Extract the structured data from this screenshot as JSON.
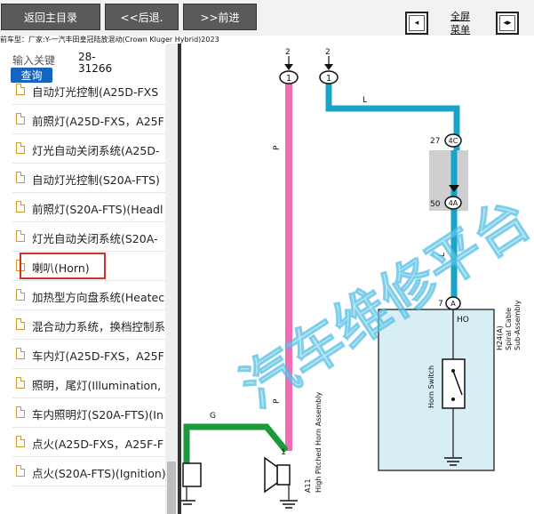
{
  "toolbar": {
    "home_label": "返回主目录",
    "back_label": "<<后退.",
    "forward_label": ">>前进",
    "fullscreen_line1": "全屏",
    "fullscreen_line2": "菜单"
  },
  "vehicle_info": "前车型：厂家:Y-一汽丰田皇冠陆放混动(Crown Kluger Hybrid)2023",
  "search": {
    "label": "输入关键",
    "code_line1": "28-",
    "code_line2": "31266",
    "query_label": "查询"
  },
  "nav_items": [
    {
      "label": "自动灯光控制(A25D-FXS"
    },
    {
      "label": "前照灯(A25D-FXS，A25F"
    },
    {
      "label": "灯光自动关闭系统(A25D-"
    },
    {
      "label": "自动灯光控制(S20A-FTS)"
    },
    {
      "label": "前照灯(S20A-FTS)(Headl"
    },
    {
      "label": "灯光自动关闭系统(S20A-"
    },
    {
      "label": "喇叭(Horn)",
      "selected": true
    },
    {
      "label": "加热型方向盘系统(Heatec"
    },
    {
      "label": "混合动力系统，换档控制系"
    },
    {
      "label": "车内灯(A25D-FXS，A25F"
    },
    {
      "label": "照明，尾灯(Illumination,"
    },
    {
      "label": "车内照明灯(S20A-FTS)(In"
    },
    {
      "label": "点火(A25D-FXS，A25F-F"
    },
    {
      "label": "点火(S20A-FTS)(Ignition)"
    }
  ],
  "diagram": {
    "watermark": "汽车维修平台",
    "connector_top_left": "1",
    "connector_top_right": "1",
    "pin_top_left": "2",
    "pin_top_right": "2",
    "wire_p_upper": "P",
    "wire_p_lower": "P",
    "wire_l_upper": "L",
    "wire_l_mid": "L",
    "wire_g": "G",
    "junction_27": "27",
    "junction_27_conn": "4C",
    "junction_50": "50",
    "junction_50_conn": "4A",
    "pin_7": "7",
    "pin_7_conn": "A",
    "ho_label": "HO",
    "horn_switch_label": "Horn Switch",
    "spiral_line1": "H24(A)",
    "spiral_line2": "Spiral Cable",
    "spiral_line3": "Sub-Assembly",
    "horn_pin": "1",
    "horn_code": "A11",
    "horn_name": "High Pitched Horn Assembly",
    "colors": {
      "pink": "#f06fb4",
      "cyan": "#1aa3c8",
      "green": "#1a9a3a",
      "box": "#d6eef4",
      "gray_block": "#cfcfcf"
    }
  }
}
